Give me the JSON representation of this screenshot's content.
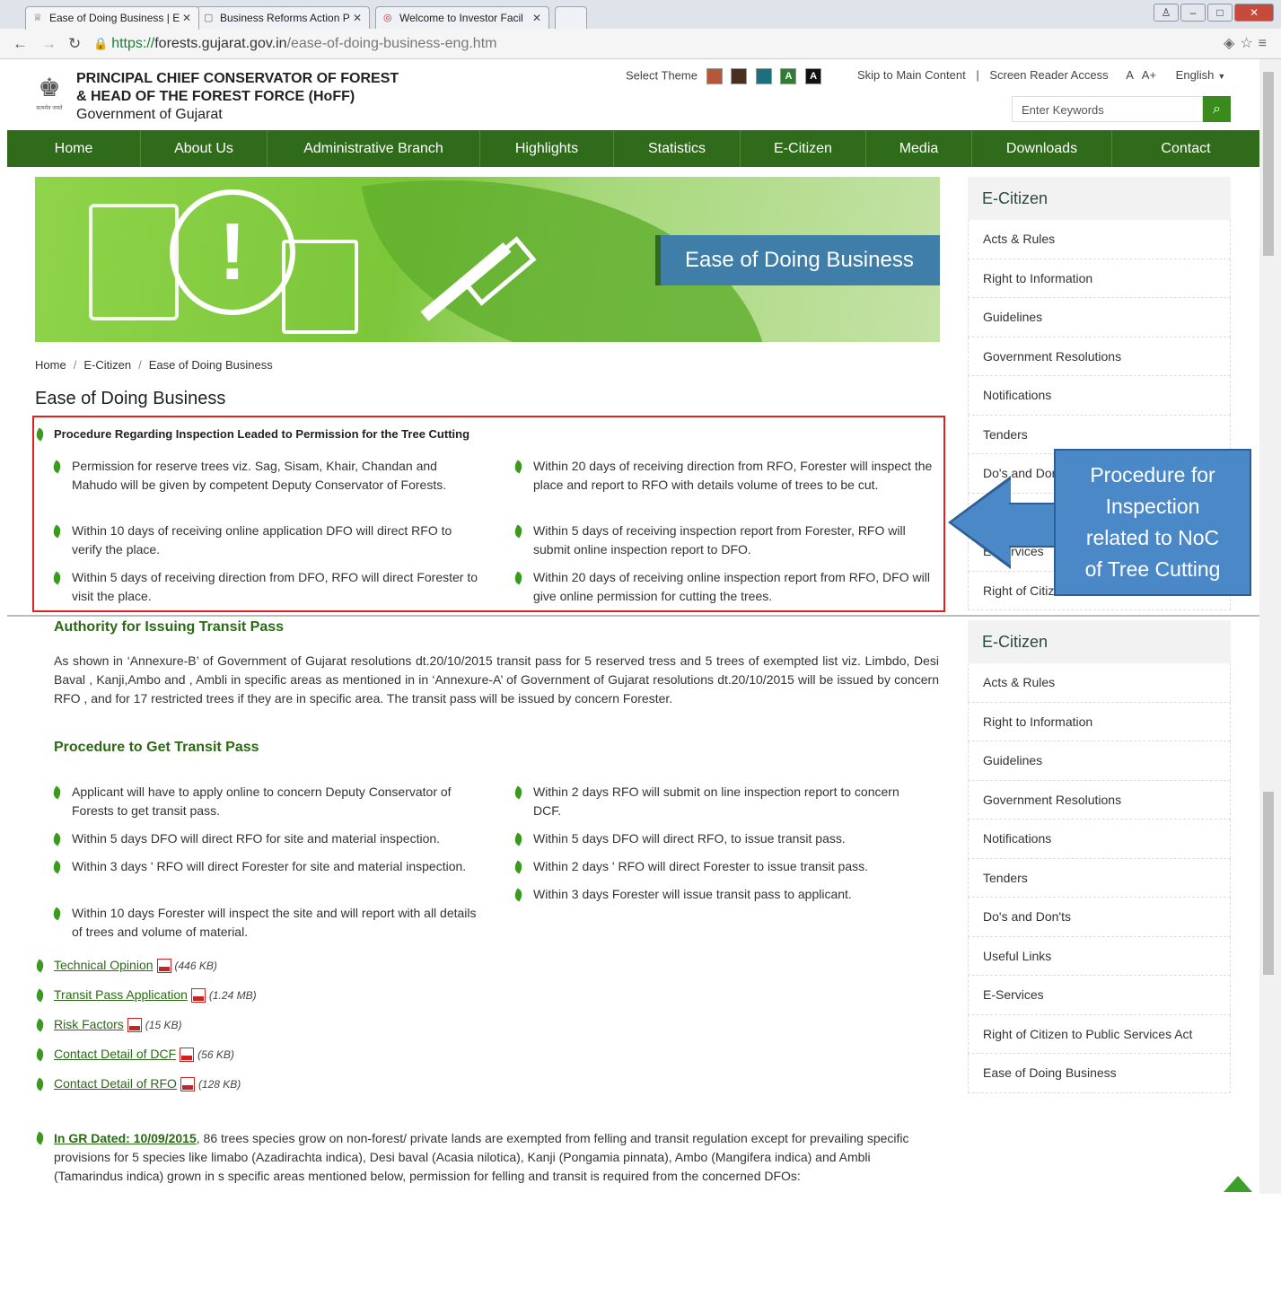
{
  "browser": {
    "tabs": [
      {
        "label": "Ease of Doing Business | E"
      },
      {
        "label": "Business Reforms Action P"
      },
      {
        "label": "Welcome to Investor Facil"
      }
    ],
    "url_https": "https://",
    "url_host": "forests.gujarat.gov.in",
    "url_path": "/ease-of-doing-business-eng.htm"
  },
  "header": {
    "org_line1": "PRINCIPAL CHIEF CONSERVATOR OF FOREST",
    "org_line2": "& HEAD OF THE HEAD OF THE FOREST FORCE (HoFF)",
    "org_line3": "Government of Gujarat",
    "emblem_text": "सत्यमेव जयते",
    "select_theme": "Select Theme",
    "skip": "Skip to Main Content",
    "pipe": "|",
    "screen_reader": "Screen Reader Access",
    "font_a": "A",
    "font_aplus": "A+",
    "language": "English",
    "search_placeholder": "Enter Keywords",
    "theme_colors": [
      "#b5583a",
      "#4a2f1e",
      "#1a6f80",
      "#2e7d32",
      "#111111"
    ]
  },
  "menu": [
    "Home",
    "About Us",
    "Administrative Branch",
    "Highlights",
    "Statistics",
    "E-Citizen",
    "Media",
    "Downloads",
    "Contact"
  ],
  "banner": {
    "title": "Ease of Doing Business"
  },
  "breadcrumb": {
    "home": "Home",
    "sep": "/",
    "ecitizen": "E-Citizen",
    "current": "Ease of Doing Business"
  },
  "page_title": "Ease of Doing Business",
  "inspection": {
    "heading": "Procedure Regarding Inspection Leaded to Permission for the Tree Cutting",
    "left": [
      "Permission for reserve trees viz. Sag, Sisam, Khair, Chandan and Mahudo will be given by competent Deputy Conservator of Forests.",
      "Within 10 days of receiving online application DFO will direct RFO to verify the place.",
      "Within 5 days of receiving direction from DFO, RFO will direct Forester to visit the place."
    ],
    "right": [
      "Within 20 days of receiving direction from RFO, Forester will inspect the place and report to RFO with details volume of trees to be cut.",
      "Within 5 days of receiving inspection report from Forester, RFO will submit online inspection report to DFO.",
      "Within 20 days of receiving online inspection report from RFO, DFO will give online permission for cutting the trees."
    ]
  },
  "transit": {
    "heading": "Authority for Issuing Transit Pass",
    "paragraph": "As shown in ‘Annexure-B’ of Government of Gujarat resolutions dt.20/10/2015 transit pass for 5 reserved tress and 5 trees of exempted list viz. Limbdo, Desi Baval , Kanji,Ambo and , Ambli in specific areas as mentioned in in ‘Annexure-A’ of Government of Gujarat resolutions dt.20/10/2015 will be issued by concern RFO , and for 17 restricted trees if they are in specific area. The transit pass will be issued by concern Forester.",
    "procedure_heading": "Procedure to Get Transit Pass",
    "left": [
      "Applicant will have to apply online to concern Deputy Conservator of Forests to get transit pass.",
      "Within 5 days DFO will direct RFO for site and material inspection.",
      "Within 3 days ' RFO will direct Forester for site and material inspection.",
      "Within 10 days Forester will inspect the site and will report with all details of trees and volume of material."
    ],
    "right": [
      "Within 2 days RFO will submit on line inspection report to concern DCF.",
      "Within 5 days DFO will direct RFO, to issue transit pass.",
      "Within 2 days ' RFO will direct Forester to issue transit pass.",
      "Within 3 days Forester will issue transit pass to applicant."
    ]
  },
  "documents": [
    {
      "label": "Technical Opinion",
      "size": "(446 KB)"
    },
    {
      "label": "Transit Pass Application",
      "size": "(1.24 MB)"
    },
    {
      "label": "Risk Factors",
      "size": "(15 KB)"
    },
    {
      "label": "Contact Detail of DCF",
      "size": "(56 KB)"
    },
    {
      "label": "Contact Detail of RFO",
      "size": "(128 KB)"
    }
  ],
  "gr": {
    "link": "In GR Dated: 10/09/2015",
    "text": ", 86 trees species grow on non-forest/ private lands are exempted from felling and transit regulation except for prevailing specific provisions for 5 species like limabo (Azadirachta indica), Desi baval (Acasia nilotica), Kanji (Pongamia pinnata), Ambo (Mangifera indica) and Ambli (Tamarindus indica) grown in s specific areas mentioned below, permission for felling and transit is required from the concerned DFOs:"
  },
  "sidebar_top": {
    "title": "E-Citizen",
    "items": [
      "Acts & Rules",
      "Right to Information",
      "Guidelines",
      "Government Resolutions",
      "Notifications",
      "Tenders",
      "Do's and Don'ts",
      "Useful Links",
      "E-Services",
      "Right of Citizen to Public Services Act"
    ]
  },
  "sidebar": {
    "title": "E-Citizen",
    "items": [
      "Acts & Rules",
      "Right to Information",
      "Guidelines",
      "Government Resolutions",
      "Notifications",
      "Tenders",
      "Do's and Don'ts",
      "Useful Links",
      "E-Services",
      "Right of Citizen to Public Services Act",
      "Ease of Doing Business"
    ]
  },
  "callout": {
    "line1": "Procedure for",
    "line2": "Inspection",
    "line3": "related to NoC",
    "line4": "of Tree Cutting"
  }
}
